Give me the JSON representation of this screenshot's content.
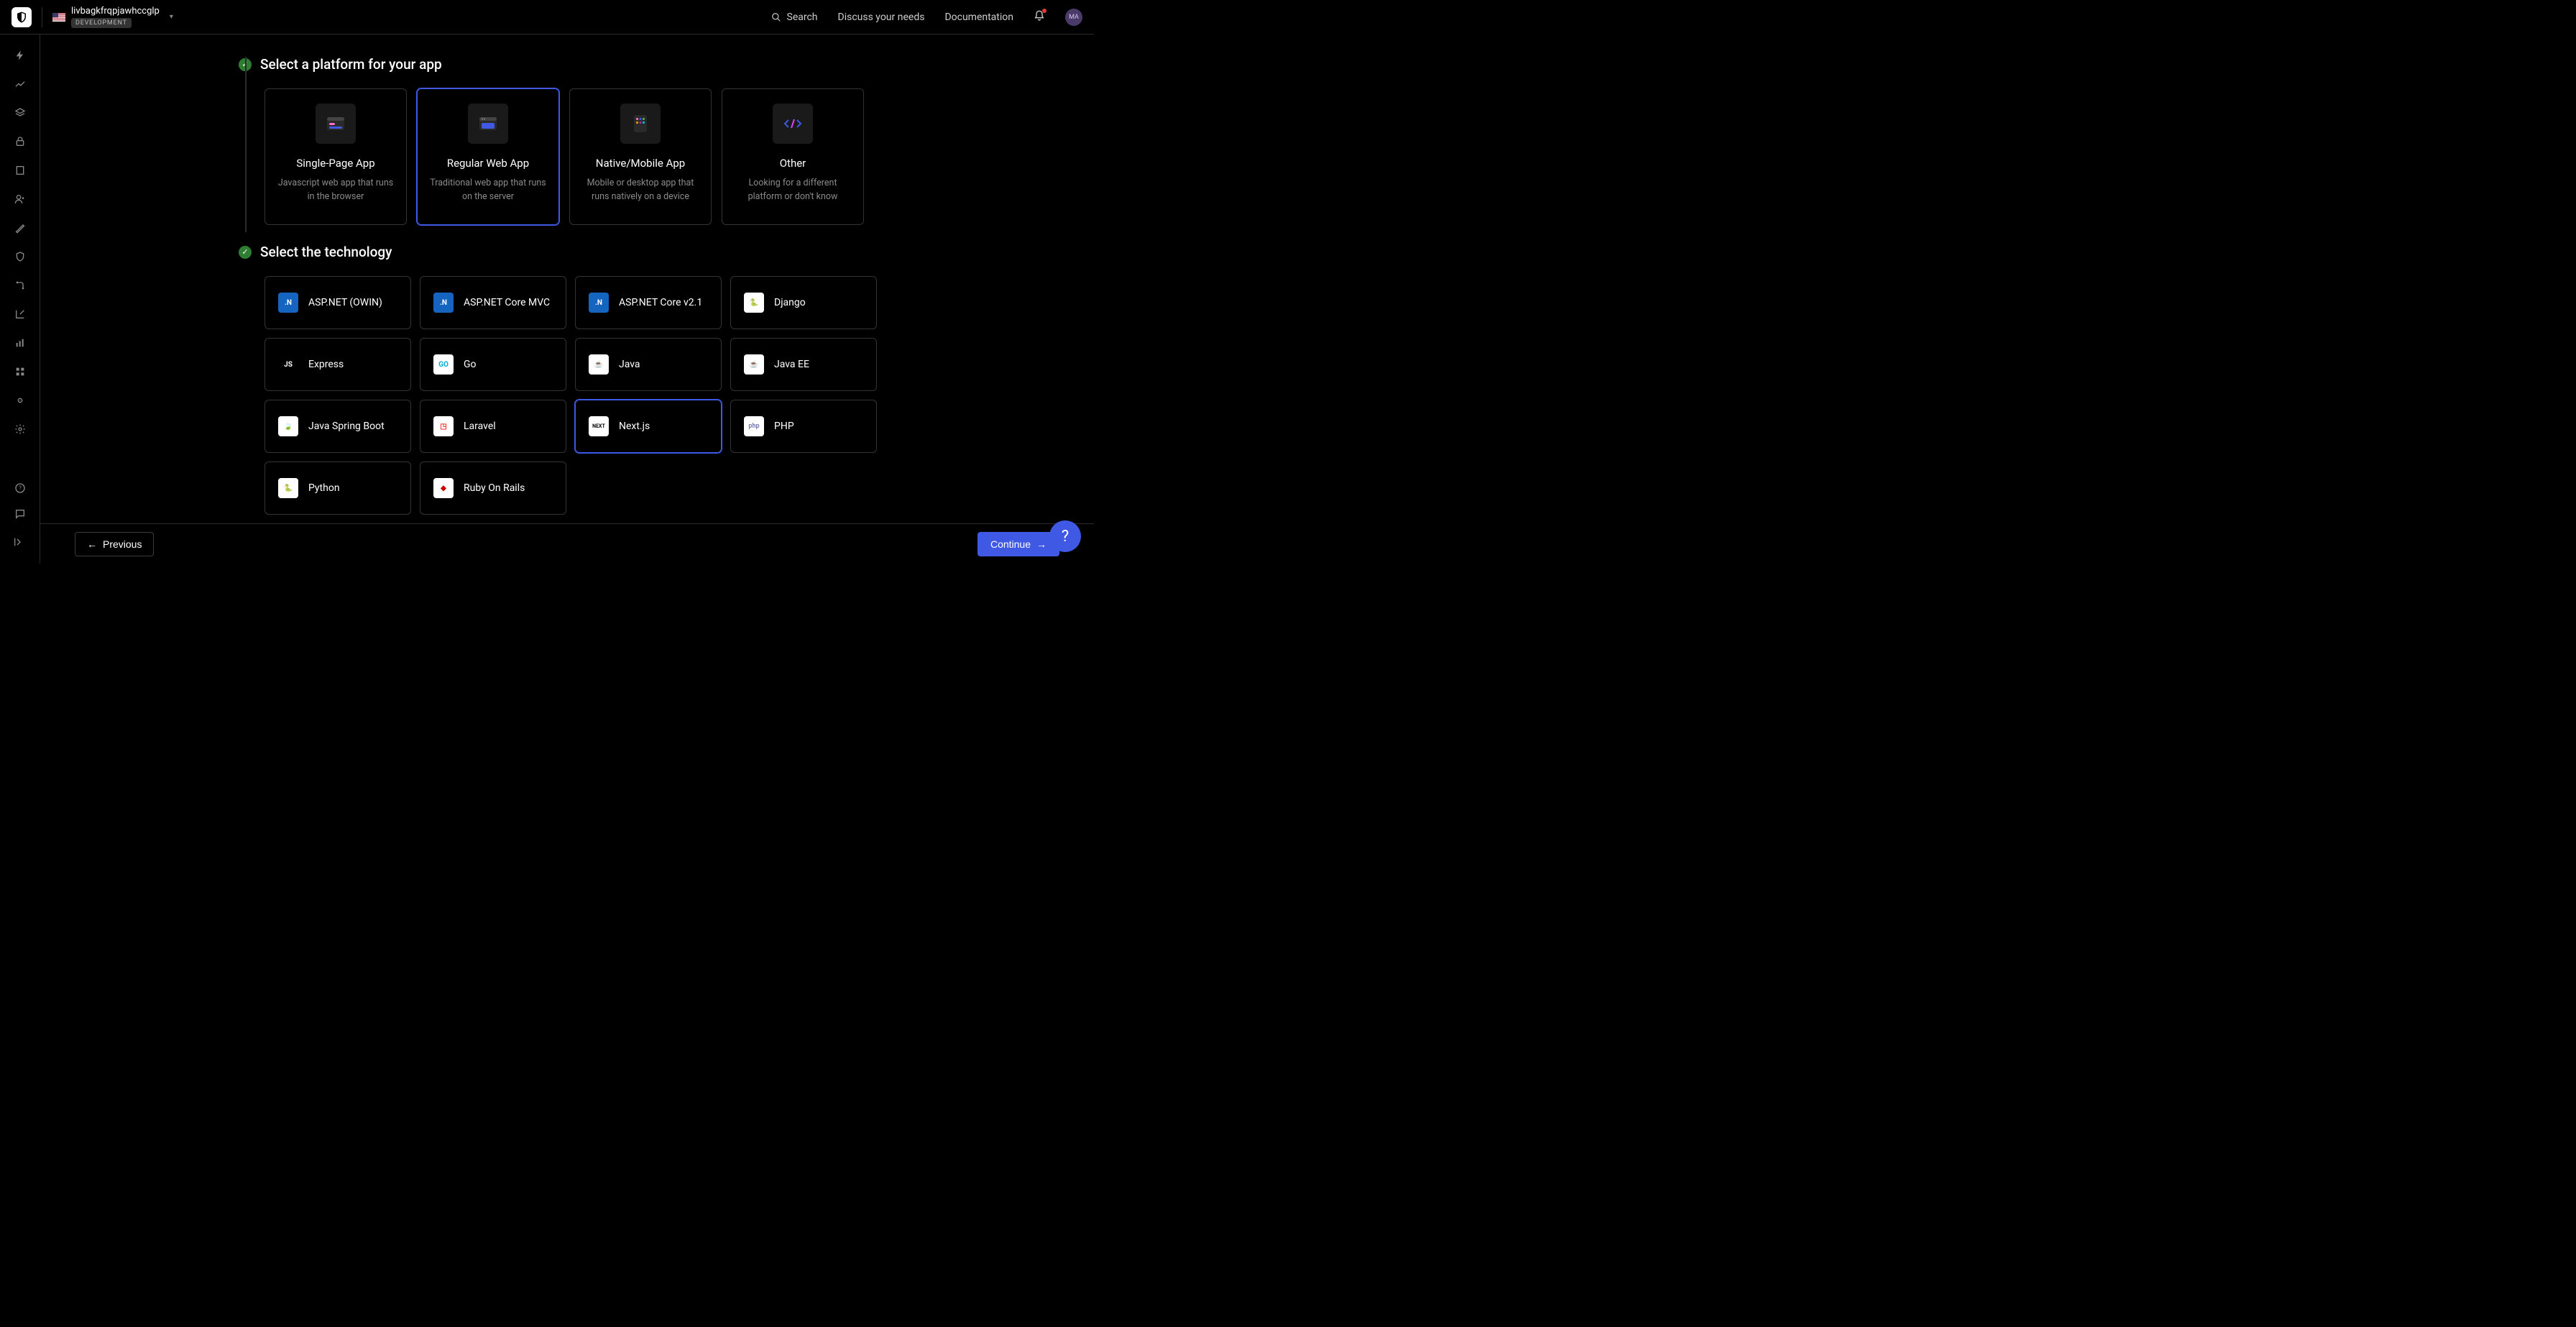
{
  "header": {
    "tenant_name": "livbagkfrqpjawhccglp",
    "env_badge": "DEVELOPMENT",
    "search_label": "Search",
    "link_discuss": "Discuss your needs",
    "link_docs": "Documentation",
    "avatar_initials": "MA"
  },
  "steps": {
    "platform_title": "Select a platform for your app",
    "technology_title": "Select the technology"
  },
  "platforms": [
    {
      "id": "spa",
      "name": "Single-Page App",
      "desc": "Javascript web app that runs in the browser"
    },
    {
      "id": "webapp",
      "name": "Regular Web App",
      "desc": "Traditional web app that runs on the server",
      "selected": true
    },
    {
      "id": "native",
      "name": "Native/Mobile App",
      "desc": "Mobile or desktop app that runs natively on a device"
    },
    {
      "id": "other",
      "name": "Other",
      "desc": "Looking for a different platform or don't know"
    }
  ],
  "technologies": [
    {
      "id": "aspnet_owin",
      "name": "ASP.NET (OWIN)",
      "icon": "dotnet"
    },
    {
      "id": "aspnet_core_mvc",
      "name": "ASP.NET Core MVC",
      "icon": "dotnet"
    },
    {
      "id": "aspnet_core_v21",
      "name": "ASP.NET Core v2.1",
      "icon": "dotnet"
    },
    {
      "id": "django",
      "name": "Django",
      "icon": "django"
    },
    {
      "id": "express",
      "name": "Express",
      "icon": "js"
    },
    {
      "id": "go",
      "name": "Go",
      "icon": "go"
    },
    {
      "id": "java",
      "name": "Java",
      "icon": "java"
    },
    {
      "id": "java_ee",
      "name": "Java EE",
      "icon": "java"
    },
    {
      "id": "spring",
      "name": "Java Spring Boot",
      "icon": "spring"
    },
    {
      "id": "laravel",
      "name": "Laravel",
      "icon": "laravel"
    },
    {
      "id": "nextjs",
      "name": "Next.js",
      "icon": "next",
      "selected": true
    },
    {
      "id": "php",
      "name": "PHP",
      "icon": "php"
    },
    {
      "id": "python",
      "name": "Python",
      "icon": "python"
    },
    {
      "id": "rails",
      "name": "Ruby On Rails",
      "icon": "rails"
    }
  ],
  "footer": {
    "previous_label": "Previous",
    "continue_label": "Continue"
  },
  "colors": {
    "accent": "#3f59e4"
  }
}
